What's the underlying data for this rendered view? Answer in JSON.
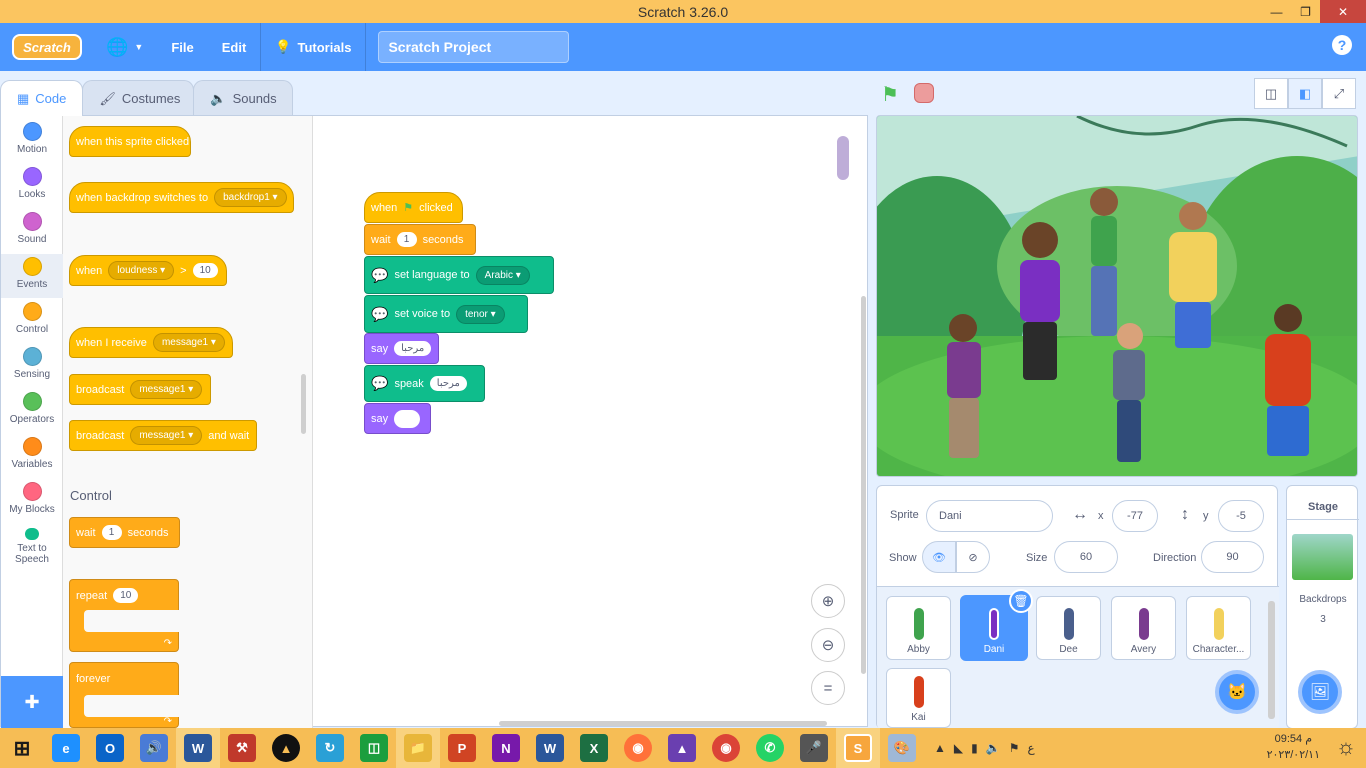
{
  "window": {
    "title": "Scratch 3.26.0"
  },
  "menu": {
    "file": "File",
    "edit": "Edit",
    "tutorials": "Tutorials",
    "project_title": "Scratch Project"
  },
  "tabs": {
    "code": "Code",
    "costumes": "Costumes",
    "sounds": "Sounds"
  },
  "categories": [
    {
      "label": "Motion",
      "color": "#4c97ff"
    },
    {
      "label": "Looks",
      "color": "#9966ff"
    },
    {
      "label": "Sound",
      "color": "#cf63cf"
    },
    {
      "label": "Events",
      "color": "#ffbf00"
    },
    {
      "label": "Control",
      "color": "#ffab19"
    },
    {
      "label": "Sensing",
      "color": "#5cb1d6"
    },
    {
      "label": "Operators",
      "color": "#59c059"
    },
    {
      "label": "Variables",
      "color": "#ff8c1a"
    },
    {
      "label": "My Blocks",
      "color": "#ff6680"
    },
    {
      "label": "Text to Speech",
      "color": "#0fbd8c"
    }
  ],
  "palette": {
    "sprite_clicked": "when this sprite clicked",
    "backdrop_switches": "when backdrop switches to",
    "backdrop_value": "backdrop1",
    "when": "when",
    "loudness": "loudness",
    "gt": ">",
    "loudness_value": "10",
    "when_receive": "when I receive",
    "message_value": "message1",
    "broadcast": "broadcast",
    "and_wait": "and wait",
    "control_title": "Control",
    "wait": "wait",
    "wait_value": "1",
    "seconds": "seconds",
    "repeat": "repeat",
    "repeat_value": "10",
    "forever": "forever"
  },
  "script": {
    "when": "when",
    "clicked": "clicked",
    "wait": "wait",
    "wait_value": "1",
    "seconds": "seconds",
    "set_language": "set language to",
    "language_value": "Arabic",
    "set_voice": "set voice to",
    "voice_value": "tenor",
    "say": "say",
    "say_value": "مرحبا",
    "speak": "speak",
    "speak_value": "مرحبا",
    "say2": "say",
    "say2_value": ""
  },
  "sprite_info": {
    "sprite_label": "Sprite",
    "sprite_name": "Dani",
    "x_label": "x",
    "x_value": "-77",
    "y_label": "y",
    "y_value": "-5",
    "show_label": "Show",
    "size_label": "Size",
    "size_value": "60",
    "direction_label": "Direction",
    "direction_value": "90"
  },
  "sprites": [
    {
      "name": "Abby",
      "color": "#3fa34d"
    },
    {
      "name": "Dani",
      "color": "#7a2fc2"
    },
    {
      "name": "Dee",
      "color": "#4a5f8c"
    },
    {
      "name": "Avery",
      "color": "#7a3b8f"
    },
    {
      "name": "Character...",
      "color": "#f2d15c"
    },
    {
      "name": "Kai",
      "color": "#d8401c"
    }
  ],
  "stage_panel": {
    "title": "Stage",
    "backdrops_label": "Backdrops",
    "backdrops_count": "3"
  },
  "clock": {
    "time": "09:54 م",
    "date": "٢٠٢٣/٠٢/١١"
  },
  "tray": {
    "lang": "ع"
  }
}
